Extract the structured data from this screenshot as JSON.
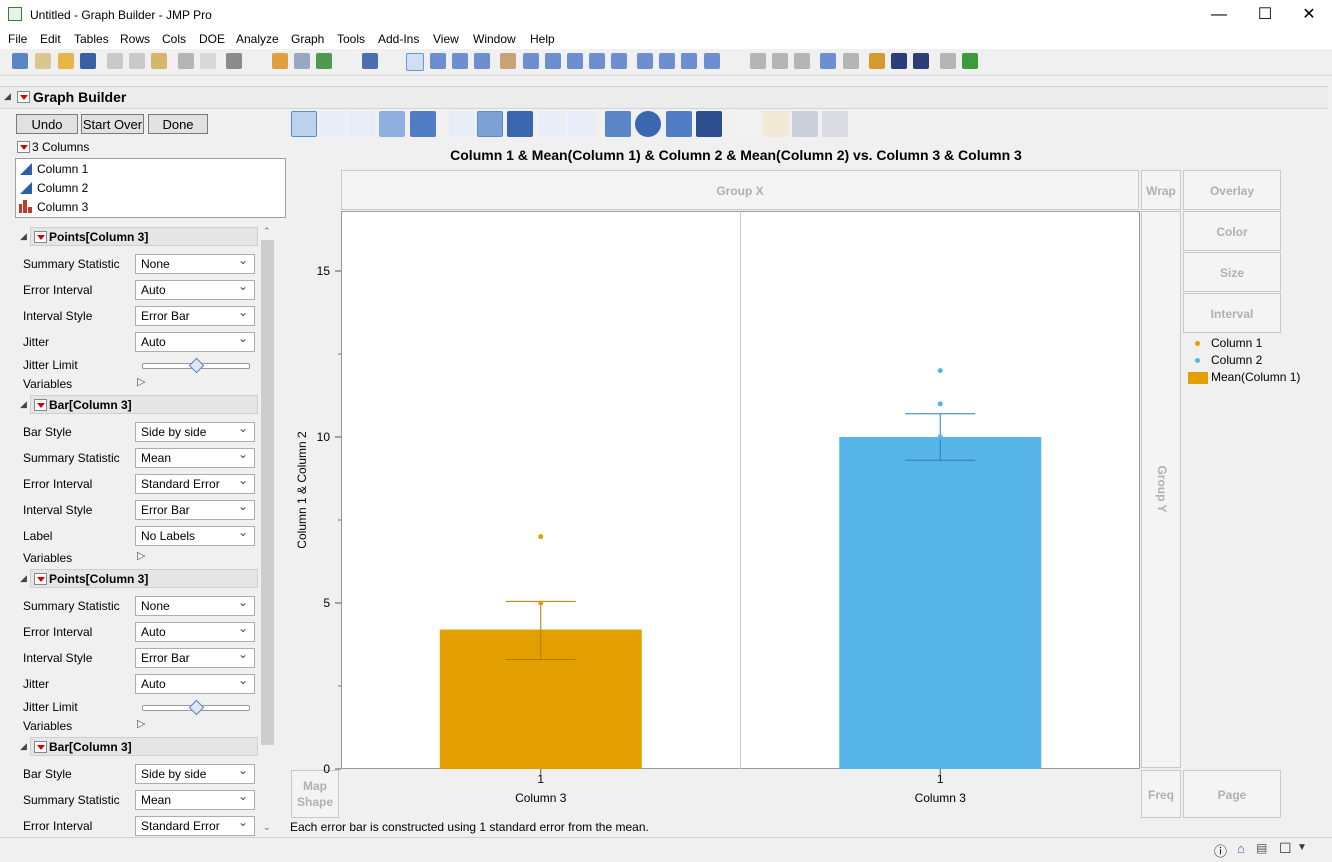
{
  "window": {
    "title": "Untitled - Graph Builder - JMP Pro",
    "minimize": "—",
    "maximize": "☐",
    "close": "✕"
  },
  "menu": [
    "File",
    "Edit",
    "Tables",
    "Rows",
    "Cols",
    "DOE",
    "Analyze",
    "Graph",
    "Tools",
    "Add-Ins",
    "View",
    "Window",
    "Help"
  ],
  "platform": {
    "title": "Graph Builder",
    "buttons": {
      "undo": "Undo",
      "start_over": "Start Over",
      "done": "Done"
    },
    "columns_header": "3 Columns",
    "columns": [
      "Column 1",
      "Column 2",
      "Column 3"
    ]
  },
  "sections": [
    {
      "title": "Points[Column 3]",
      "rows": [
        {
          "label": "Summary Statistic",
          "value": "None"
        },
        {
          "label": "Error Interval",
          "value": "Auto"
        },
        {
          "label": "Interval Style",
          "value": "Error Bar"
        },
        {
          "label": "Jitter",
          "value": "Auto"
        }
      ],
      "jitter_limit_label": "Jitter Limit",
      "jitter_limit_level": 0.5,
      "variables_label": "Variables"
    },
    {
      "title": "Bar[Column 3]",
      "rows": [
        {
          "label": "Bar Style",
          "value": "Side by side"
        },
        {
          "label": "Summary Statistic",
          "value": "Mean"
        },
        {
          "label": "Error Interval",
          "value": "Standard Error"
        },
        {
          "label": "Interval Style",
          "value": "Error Bar"
        },
        {
          "label": "Label",
          "value": "No Labels"
        }
      ],
      "variables_label": "Variables"
    },
    {
      "title": "Points[Column 3]",
      "rows": [
        {
          "label": "Summary Statistic",
          "value": "None"
        },
        {
          "label": "Error Interval",
          "value": "Auto"
        },
        {
          "label": "Interval Style",
          "value": "Error Bar"
        },
        {
          "label": "Jitter",
          "value": "Auto"
        }
      ],
      "jitter_limit_label": "Jitter Limit",
      "jitter_limit_level": 0.5,
      "variables_label": "Variables"
    },
    {
      "title": "Bar[Column 3]",
      "rows": [
        {
          "label": "Bar Style",
          "value": "Side by side"
        },
        {
          "label": "Summary Statistic",
          "value": "Mean"
        },
        {
          "label": "Error Interval",
          "value": "Standard Error"
        }
      ]
    }
  ],
  "zones": {
    "group_x": "Group X",
    "group_y": "Group Y",
    "wrap": "Wrap",
    "overlay": "Overlay",
    "color": "Color",
    "size": "Size",
    "interval": "Interval",
    "freq": "Freq",
    "page": "Page",
    "map_shape_1": "Map",
    "map_shape_2": "Shape"
  },
  "footnote": "Each error bar is constructed using 1 standard error from the mean.",
  "colors": {
    "column1": "#e39f00",
    "column2": "#56b4e9",
    "bar1": "#e39f00",
    "bar2": "#56b4e9"
  },
  "chart_data": {
    "type": "bar",
    "title": "Column 1 & Mean(Column 1) & Column 2 & Mean(Column 2) vs. Column 3 & Column 3",
    "ylabel": "Column 1 & Column 2",
    "ylim": [
      0,
      15
    ],
    "yticks": [
      0,
      5,
      10,
      15
    ],
    "panels": [
      {
        "xlabel": "Column 3",
        "category": "1",
        "bar_series": "Mean(Column 1)",
        "bar_value": 4.2,
        "error_low": 3.3,
        "error_high": 5.05,
        "points": [
          7.0,
          5.0
        ],
        "point_series": "Column 1"
      },
      {
        "xlabel": "Column 3",
        "category": "1",
        "bar_series": "Mean(Column 2)",
        "bar_value": 10.0,
        "error_low": 9.3,
        "error_high": 10.7,
        "points": [
          12.0,
          11.0,
          10.0
        ],
        "point_series": "Column 2"
      }
    ],
    "legend": [
      "Column 1",
      "Column 2",
      "Mean(Column 1)"
    ],
    "legend_position": "right"
  }
}
